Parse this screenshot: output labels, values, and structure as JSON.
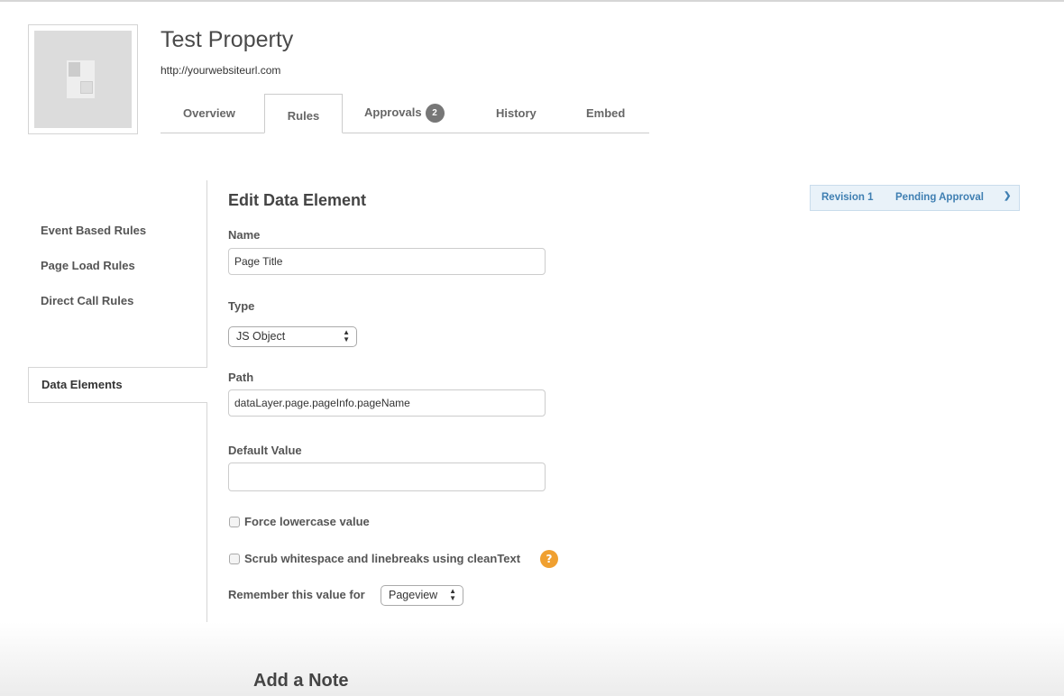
{
  "property": {
    "title": "Test Property",
    "url": "http://yourwebsiteurl.com"
  },
  "tabs": [
    {
      "label": "Overview"
    },
    {
      "label": "Rules",
      "active": true
    },
    {
      "label": "Approvals",
      "badge": "2"
    },
    {
      "label": "History"
    },
    {
      "label": "Embed"
    }
  ],
  "sidebar": {
    "items": [
      {
        "label": "Event Based Rules"
      },
      {
        "label": "Page Load Rules"
      },
      {
        "label": "Direct Call Rules"
      },
      {
        "label": "Data Elements",
        "active": true
      }
    ]
  },
  "revision": {
    "label": "Revision 1",
    "status": "Pending Approval"
  },
  "form": {
    "heading": "Edit Data Element",
    "name_label": "Name",
    "name_value": "Page Title",
    "type_label": "Type",
    "type_value": "JS Object",
    "path_label": "Path",
    "path_value": "dataLayer.page.pageInfo.pageName",
    "default_label": "Default Value",
    "default_value": "",
    "force_lowercase": "Force lowercase value",
    "scrub": "Scrub whitespace and linebreaks using cleanText",
    "remember_label": "Remember this value for",
    "remember_value": "Pageview"
  },
  "note": {
    "heading": "Add a Note"
  },
  "colors": {
    "accent": "#3f7fb2",
    "help": "#f0a030",
    "badge": "#777777"
  }
}
